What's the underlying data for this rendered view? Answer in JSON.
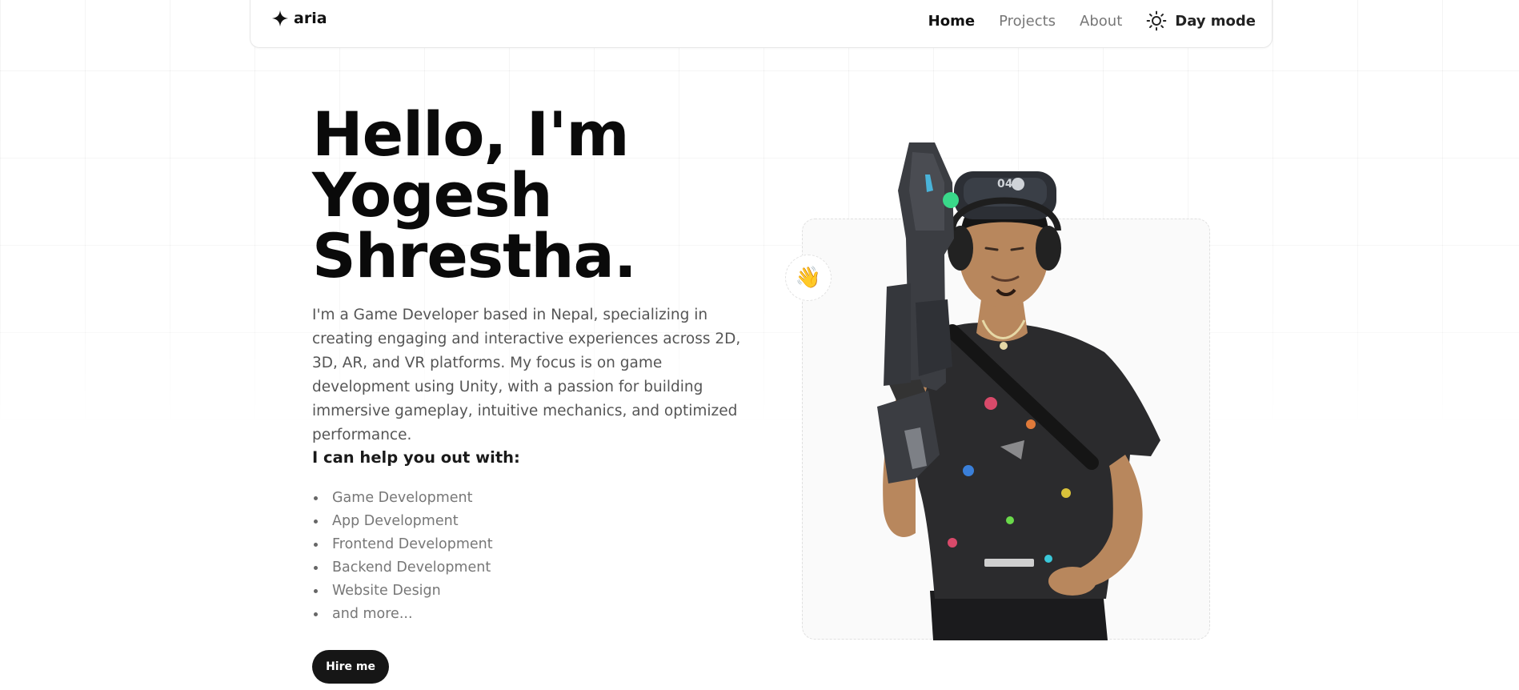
{
  "header": {
    "logo_text": "aria",
    "nav": [
      {
        "label": "Home",
        "active": true
      },
      {
        "label": "Projects",
        "active": false
      },
      {
        "label": "About",
        "active": false
      }
    ],
    "mode_label": "Day mode",
    "mode_icon": "sun-icon"
  },
  "hero": {
    "title_lines": [
      "Hello, I'm",
      "Yogesh",
      "Shrestha."
    ],
    "intro": "I'm a Game Developer based in Nepal, specializing in creating engaging and interactive experiences across 2D, 3D, AR, and VR platforms. My focus is on game development using Unity, with a passion for building immersive gameplay, intuitive mechanics, and optimized performance.",
    "help_heading": "I can help you out with:",
    "services": [
      "Game Development",
      "App Development",
      "Frontend Development",
      "Backend Development",
      "Website Design",
      "and more..."
    ],
    "cta_label": "Hire me"
  },
  "portrait": {
    "badge_emoji": "👋",
    "badge_icon": "waving-hand-icon"
  },
  "colors": {
    "text_primary": "#0a0a0a",
    "text_secondary": "#555555",
    "cta_background": "#161616",
    "cta_text": "#ffffff"
  }
}
